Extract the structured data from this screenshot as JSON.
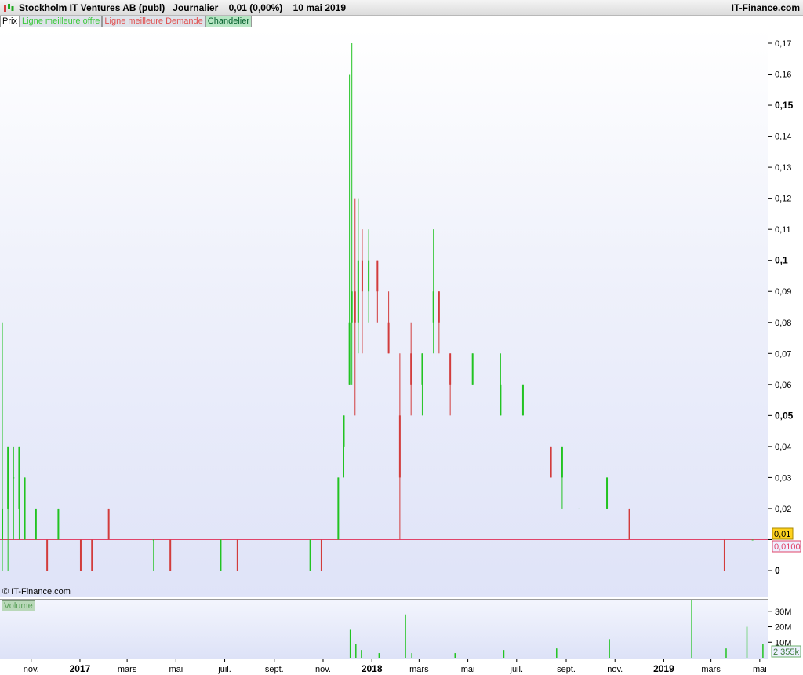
{
  "window": {
    "title": "Stockholm IT Ventures AB (publ)   Journalier    0,01 (0,00%)    10 mai 2019",
    "brand": "IT-Finance.com"
  },
  "legend": {
    "prix": "Prix",
    "offre": "Ligne meilleure offre",
    "demande": "Ligne meilleure Demande",
    "chandelier": "Chandelier"
  },
  "copyright": "© IT-Finance.com",
  "volume_label": "Volume",
  "price_badge": "0,01",
  "price_badge_secondary": "0,0100",
  "volume_badge": "2 355k",
  "colors": {
    "up": "#22c322",
    "down": "#d23c3c",
    "magenta": "#ff00cc",
    "bid_line": "#e0446a",
    "badge_yellow": "#ffd21e"
  },
  "chart_data": {
    "type": "candlestick",
    "title": "Stockholm IT Ventures AB (publ)",
    "interval": "Journalier",
    "last_price": "0,01",
    "change": "0,00%",
    "date": "10 mai 2019",
    "price_axis": {
      "min": -0.01,
      "max": 0.175,
      "ticks": [
        0,
        0.01,
        0.02,
        0.03,
        0.04,
        0.05,
        0.06,
        0.07,
        0.08,
        0.09,
        0.1,
        0.11,
        0.12,
        0.13,
        0.14,
        0.15,
        0.16,
        0.17
      ],
      "tick_labels": [
        "0",
        "0,01",
        "0,02",
        "0,03",
        "0,04",
        "0,05",
        "0,06",
        "0,07",
        "0,08",
        "0,09",
        "0,1",
        "0,11",
        "0,12",
        "0,13",
        "0,14",
        "0,15",
        "0,16",
        "0,17"
      ],
      "bold_ticks": [
        "0",
        "0,05",
        "0,1",
        "0,15"
      ]
    },
    "bid_line": 0.01,
    "volume_axis": {
      "min": 0,
      "max": 38000000,
      "ticks": [
        10000000,
        20000000,
        30000000
      ],
      "tick_labels": [
        "10M",
        "20M",
        "30M"
      ]
    },
    "x_axis": {
      "start": "2016-09-25",
      "end": "2019-05-10",
      "labels": [
        {
          "date": "2016-11-01",
          "label": "nov.",
          "year": false
        },
        {
          "date": "2017-01-01",
          "label": "2017",
          "year": true
        },
        {
          "date": "2017-03-01",
          "label": "mars",
          "year": false
        },
        {
          "date": "2017-05-01",
          "label": "mai",
          "year": false
        },
        {
          "date": "2017-07-01",
          "label": "juil.",
          "year": false
        },
        {
          "date": "2017-09-01",
          "label": "sept.",
          "year": false
        },
        {
          "date": "2017-11-01",
          "label": "nov.",
          "year": false
        },
        {
          "date": "2018-01-01",
          "label": "2018",
          "year": true
        },
        {
          "date": "2018-03-01",
          "label": "mars",
          "year": false
        },
        {
          "date": "2018-05-01",
          "label": "mai",
          "year": false
        },
        {
          "date": "2018-07-01",
          "label": "juil.",
          "year": false
        },
        {
          "date": "2018-09-01",
          "label": "sept.",
          "year": false
        },
        {
          "date": "2018-11-01",
          "label": "nov.",
          "year": false
        },
        {
          "date": "2019-01-01",
          "label": "2019",
          "year": true
        },
        {
          "date": "2019-03-01",
          "label": "mars",
          "year": false
        },
        {
          "date": "2019-05-01",
          "label": "mai",
          "year": false
        }
      ]
    },
    "candles": [
      {
        "date": "2016-09-26",
        "open": 0.01,
        "high": 0.08,
        "low": 0.0,
        "close": 0.02
      },
      {
        "date": "2016-10-03",
        "open": 0.02,
        "high": 0.04,
        "low": 0.0,
        "close": 0.04
      },
      {
        "date": "2016-10-10",
        "open": 0.03,
        "high": 0.04,
        "low": 0.01,
        "close": 0.03
      },
      {
        "date": "2016-10-17",
        "open": 0.02,
        "high": 0.04,
        "low": 0.01,
        "close": 0.04
      },
      {
        "date": "2016-10-24",
        "open": 0.01,
        "high": 0.03,
        "low": 0.01,
        "close": 0.03
      },
      {
        "date": "2016-11-07",
        "open": 0.01,
        "high": 0.02,
        "low": 0.01,
        "close": 0.02
      },
      {
        "date": "2016-11-21",
        "open": 0.01,
        "high": 0.01,
        "low": 0.0,
        "close": 0.0
      },
      {
        "date": "2016-12-05",
        "open": 0.01,
        "high": 0.02,
        "low": 0.01,
        "close": 0.02
      },
      {
        "date": "2017-01-02",
        "open": 0.01,
        "high": 0.01,
        "low": 0.0,
        "close": 0.0
      },
      {
        "date": "2017-01-16",
        "open": 0.01,
        "high": 0.01,
        "low": 0.0,
        "close": 0.0
      },
      {
        "date": "2017-02-06",
        "open": 0.02,
        "high": 0.02,
        "low": 0.01,
        "close": 0.01
      },
      {
        "date": "2017-04-03",
        "open": 0.01,
        "high": 0.01,
        "low": 0.0,
        "close": 0.01
      },
      {
        "date": "2017-04-24",
        "open": 0.01,
        "high": 0.01,
        "low": 0.0,
        "close": 0.0
      },
      {
        "date": "2017-06-26",
        "open": 0.0,
        "high": 0.01,
        "low": 0.0,
        "close": 0.01
      },
      {
        "date": "2017-07-17",
        "open": 0.01,
        "high": 0.01,
        "low": 0.0,
        "close": 0.0
      },
      {
        "date": "2017-10-16",
        "open": 0.0,
        "high": 0.01,
        "low": 0.0,
        "close": 0.01
      },
      {
        "date": "2017-10-30",
        "open": 0.01,
        "high": 0.01,
        "low": 0.0,
        "close": 0.0
      },
      {
        "date": "2017-11-20",
        "open": 0.01,
        "high": 0.03,
        "low": 0.01,
        "close": 0.03
      },
      {
        "date": "2017-11-27",
        "open": 0.04,
        "high": 0.05,
        "low": 0.03,
        "close": 0.05
      },
      {
        "date": "2017-12-04",
        "open": 0.06,
        "high": 0.16,
        "low": 0.06,
        "close": 0.08
      },
      {
        "date": "2017-12-07",
        "open": 0.08,
        "high": 0.17,
        "low": 0.06,
        "close": 0.09
      },
      {
        "date": "2017-12-11",
        "open": 0.09,
        "high": 0.12,
        "low": 0.05,
        "close": 0.08
      },
      {
        "date": "2017-12-15",
        "open": 0.08,
        "high": 0.12,
        "low": 0.07,
        "close": 0.1
      },
      {
        "date": "2017-12-20",
        "open": 0.1,
        "high": 0.11,
        "low": 0.07,
        "close": 0.09
      },
      {
        "date": "2017-12-28",
        "open": 0.09,
        "high": 0.11,
        "low": 0.08,
        "close": 0.1
      },
      {
        "date": "2018-01-08",
        "open": 0.1,
        "high": 0.1,
        "low": 0.08,
        "close": 0.09
      },
      {
        "date": "2018-01-22",
        "open": 0.08,
        "high": 0.09,
        "low": 0.07,
        "close": 0.07
      },
      {
        "date": "2018-02-05",
        "open": 0.05,
        "high": 0.07,
        "low": 0.01,
        "close": 0.03
      },
      {
        "date": "2018-02-19",
        "open": 0.07,
        "high": 0.08,
        "low": 0.05,
        "close": 0.06
      },
      {
        "date": "2018-03-05",
        "open": 0.06,
        "high": 0.07,
        "low": 0.05,
        "close": 0.07
      },
      {
        "date": "2018-03-19",
        "open": 0.08,
        "high": 0.11,
        "low": 0.07,
        "close": 0.09
      },
      {
        "date": "2018-03-26",
        "open": 0.09,
        "high": 0.09,
        "low": 0.07,
        "close": 0.08
      },
      {
        "date": "2018-04-09",
        "open": 0.07,
        "high": 0.07,
        "low": 0.05,
        "close": 0.06
      },
      {
        "date": "2018-05-07",
        "open": 0.06,
        "high": 0.07,
        "low": 0.06,
        "close": 0.07
      },
      {
        "date": "2018-06-11",
        "open": 0.05,
        "high": 0.07,
        "low": 0.05,
        "close": 0.06
      },
      {
        "date": "2018-07-09",
        "open": 0.05,
        "high": 0.06,
        "low": 0.05,
        "close": 0.06
      },
      {
        "date": "2018-08-13",
        "open": 0.04,
        "high": 0.04,
        "low": 0.03,
        "close": 0.03
      },
      {
        "date": "2018-08-27",
        "open": 0.03,
        "high": 0.04,
        "low": 0.02,
        "close": 0.04
      },
      {
        "date": "2018-09-17",
        "open": 0.02,
        "high": 0.02,
        "low": 0.02,
        "close": 0.02
      },
      {
        "date": "2018-10-22",
        "open": 0.02,
        "high": 0.03,
        "low": 0.02,
        "close": 0.03
      },
      {
        "date": "2018-11-19",
        "open": 0.02,
        "high": 0.02,
        "low": 0.01,
        "close": 0.01
      },
      {
        "date": "2019-03-18",
        "open": 0.01,
        "high": 0.01,
        "low": 0.0,
        "close": 0.0
      },
      {
        "date": "2019-04-22",
        "open": 0.01,
        "high": 0.01,
        "low": 0.01,
        "close": 0.01
      }
    ],
    "volumes": [
      {
        "date": "2017-12-05",
        "value": 18000000
      },
      {
        "date": "2017-12-12",
        "value": 9000000
      },
      {
        "date": "2017-12-19",
        "value": 5000000
      },
      {
        "date": "2018-01-10",
        "value": 3000000
      },
      {
        "date": "2018-02-12",
        "value": 28000000
      },
      {
        "date": "2018-02-20",
        "value": 3000000
      },
      {
        "date": "2018-04-15",
        "value": 3000000
      },
      {
        "date": "2018-06-15",
        "value": 5000000
      },
      {
        "date": "2018-08-20",
        "value": 6000000
      },
      {
        "date": "2018-10-25",
        "value": 12000000
      },
      {
        "date": "2019-02-05",
        "value": 37000000
      },
      {
        "date": "2019-03-20",
        "value": 6000000
      },
      {
        "date": "2019-04-15",
        "value": 20000000
      },
      {
        "date": "2019-05-05",
        "value": 9000000
      }
    ]
  }
}
